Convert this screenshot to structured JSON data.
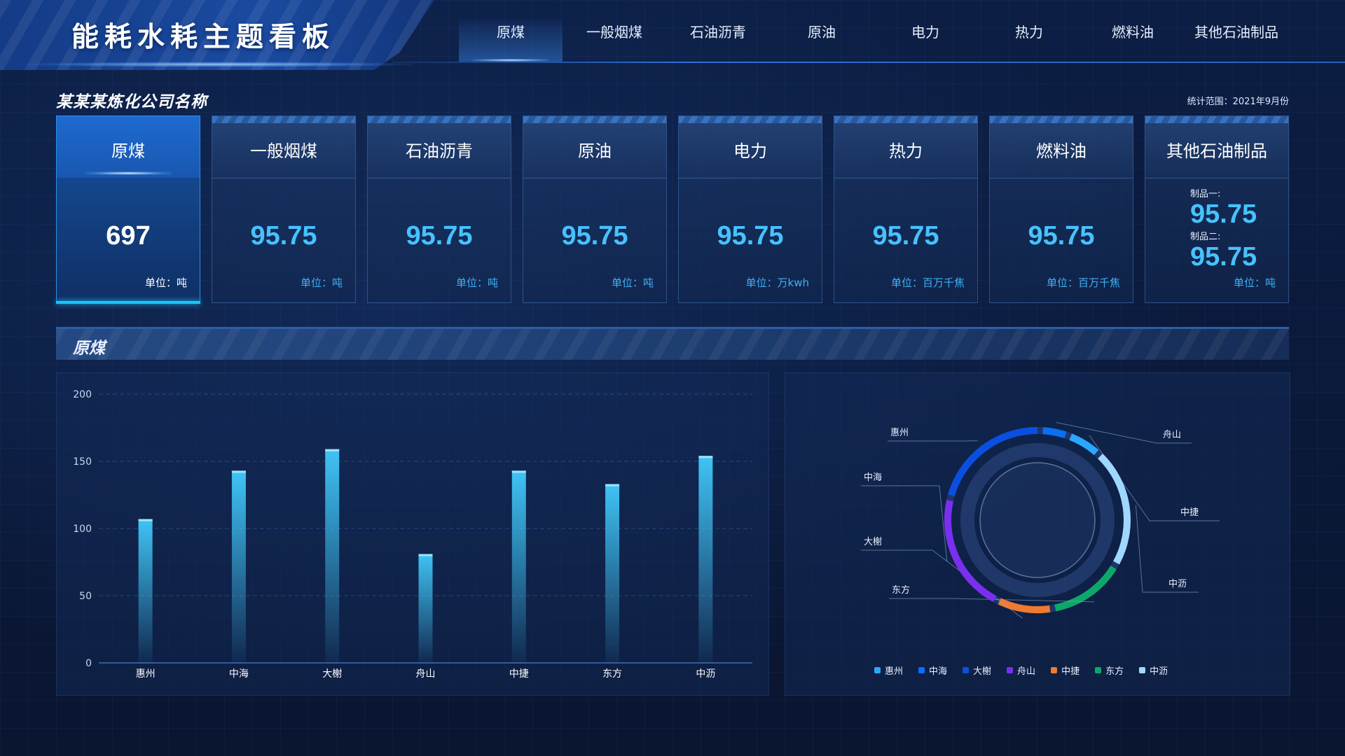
{
  "header": {
    "title": "能耗水耗主题看板",
    "nav": [
      "原煤",
      "一般烟煤",
      "石油沥青",
      "原油",
      "电力",
      "热力",
      "燃料油",
      "其他石油制品"
    ],
    "active_nav": 0
  },
  "company": {
    "name": "某某某炼化公司名称",
    "stat_range": "统计范围：2021年9月份"
  },
  "cards": [
    {
      "title": "原煤",
      "value": "697",
      "unit": "单位：吨",
      "active": true
    },
    {
      "title": "一般烟煤",
      "value": "95.75",
      "unit": "单位：吨"
    },
    {
      "title": "石油沥青",
      "value": "95.75",
      "unit": "单位：吨"
    },
    {
      "title": "原油",
      "value": "95.75",
      "unit": "单位：吨"
    },
    {
      "title": "电力",
      "value": "95.75",
      "unit": "单位：万kwh"
    },
    {
      "title": "热力",
      "value": "95.75",
      "unit": "单位：百万千焦"
    },
    {
      "title": "燃料油",
      "value": "95.75",
      "unit": "单位：百万千焦"
    },
    {
      "title": "其他石油制品",
      "items": [
        {
          "label": "制品一:",
          "value": "95.75"
        },
        {
          "label": "制品二:",
          "value": "95.75"
        }
      ],
      "unit": "单位：吨"
    }
  ],
  "section": {
    "title": "原煤"
  },
  "chart_data": [
    {
      "type": "bar",
      "categories": [
        "惠州",
        "中海",
        "大榭",
        "舟山",
        "中捷",
        "东方",
        "中沥"
      ],
      "values": [
        107,
        143,
        159,
        81,
        143,
        133,
        154
      ],
      "ylim": [
        0,
        200
      ],
      "yticks": [
        0,
        50,
        100,
        150,
        200
      ],
      "color": "#3fc4f5"
    },
    {
      "type": "pie",
      "categories": [
        "惠州",
        "中海",
        "大榭",
        "舟山",
        "中捷",
        "东方",
        "中沥"
      ],
      "values": [
        17,
        17,
        8,
        4,
        5,
        11,
        17
      ],
      "colors": [
        "#2aa7ff",
        "#0a6dff",
        "#0a4fe0",
        "#7a2ff0",
        "#f07a30",
        "#0ca86a",
        "#9fd8ff"
      ],
      "order": [
        "舟山",
        "中捷",
        "中沥",
        "东方",
        "大榭",
        "中海",
        "惠州"
      ],
      "ring_colors": [
        "#0a6ff0",
        "#2aa7ff",
        "#9fd8ff",
        "#0ca86a",
        "#f07a30",
        "#7a2ff0",
        "#0a4fe0"
      ],
      "legend_position": "bottom"
    }
  ]
}
